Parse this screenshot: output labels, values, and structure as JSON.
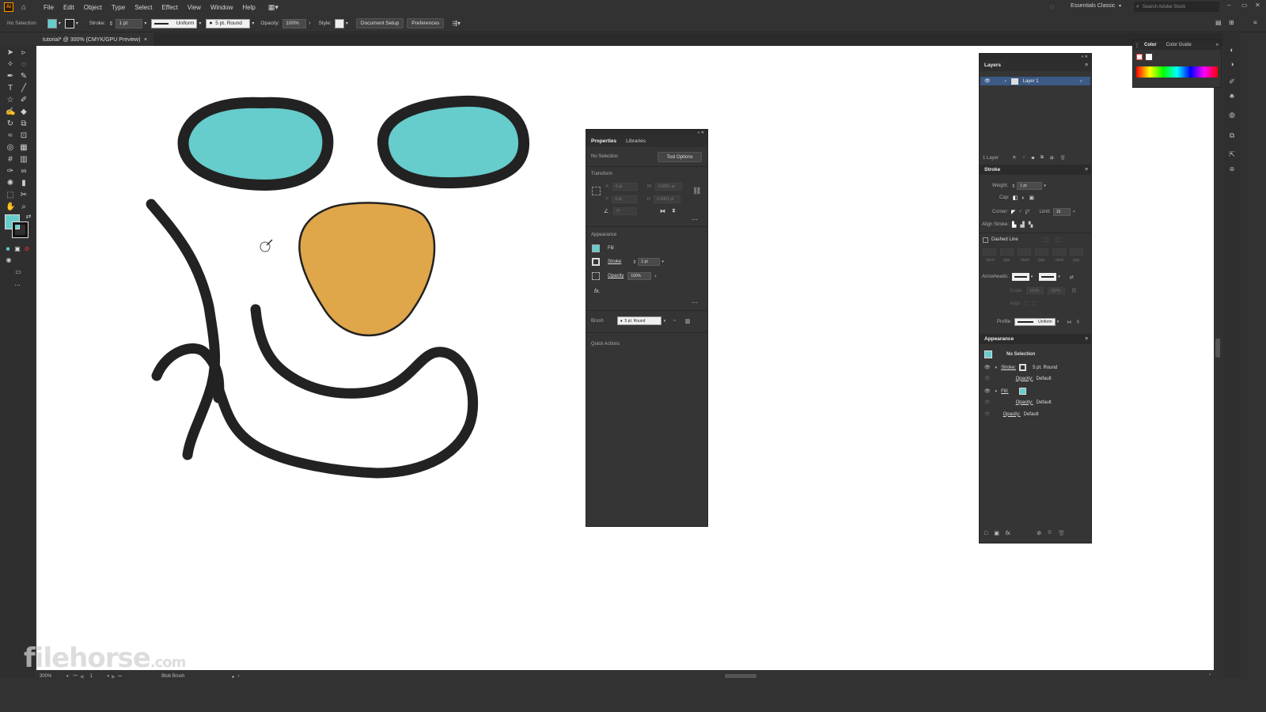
{
  "menubar": {
    "logo": "Ai",
    "items": [
      "File",
      "Edit",
      "Object",
      "Type",
      "Select",
      "Effect",
      "View",
      "Window",
      "Help"
    ],
    "workspace": "Essentials Classic",
    "search_placeholder": "Search Adobe Stock"
  },
  "controlbar": {
    "selection": "No Selection",
    "stroke_label": "Stroke:",
    "stroke_weight": "1 pt",
    "profile": "Uniform",
    "brush": "5 pt. Round",
    "opacity_label": "Opacity:",
    "opacity_value": "100%",
    "style_label": "Style:",
    "document_setup": "Document Setup",
    "preferences": "Preferences"
  },
  "doc_tab": {
    "title": "tutorial* @ 300% (CMYK/GPU Preview)",
    "close": "×"
  },
  "colors": {
    "fill": "#66cccc",
    "nose": "#e0a64a",
    "stroke": "#222222",
    "selected": "#3b5a86"
  },
  "properties_panel": {
    "tabs": [
      "Properties",
      "Libraries"
    ],
    "selection": "No Selection",
    "tool_options": "Tool Options",
    "transform_label": "Transform",
    "x_label": "X:",
    "y_label": "Y:",
    "w_label": "W:",
    "h_label": "H:",
    "x": "0 pt",
    "y": "0 pt",
    "w": "0.0001 pt",
    "h": "0.0001 pt",
    "angle": "0°",
    "appearance_label": "Appearance",
    "fill_label": "Fill",
    "stroke_label": "Stroke",
    "stroke_value": "1 pt",
    "opacity_label": "Opacity",
    "opacity_value": "100%",
    "fx": "fx.",
    "brush_label": "Brush",
    "brush_value": "5 pt. Round",
    "quick_actions": "Quick Actions"
  },
  "layers_panel": {
    "title": "Layers",
    "layer_name": "Layer 1",
    "layer_count": "1 Layer"
  },
  "stroke_panel": {
    "title": "Stroke",
    "weight_label": "Weight:",
    "weight": "1 pt",
    "cap_label": "Cap:",
    "corner_label": "Corner:",
    "limit_label": "Limit:",
    "limit": "10",
    "align_label": "Align Stroke:",
    "dashed_label": "Dashed Line",
    "dash_labels": [
      "dash",
      "gap",
      "dash",
      "gap",
      "dash",
      "gap"
    ],
    "arrowheads_label": "Arrowheads:",
    "scale_label": "Scale:",
    "scale_values": [
      "100%",
      "100%"
    ],
    "align_arrow_label": "Align:",
    "profile_label": "Profile:",
    "profile": "Uniform"
  },
  "appearance_panel": {
    "title": "Appearance",
    "selection": "No Selection",
    "rows": [
      {
        "label": "Stroke:",
        "value": "5 pt. Round"
      },
      {
        "label": "Opacity:",
        "value": "Default"
      },
      {
        "label": "Fill:",
        "value": ""
      },
      {
        "label": "Opacity:",
        "value": "Default"
      },
      {
        "label": "Opacity:",
        "value": "Default"
      }
    ]
  },
  "color_panel": {
    "tabs": [
      "Color",
      "Color Guide"
    ]
  },
  "statusbar": {
    "zoom": "300%",
    "artboard": "1",
    "tool": "Blob Brush"
  },
  "watermark": {
    "brand": "filehorse",
    "tld": ".com"
  }
}
